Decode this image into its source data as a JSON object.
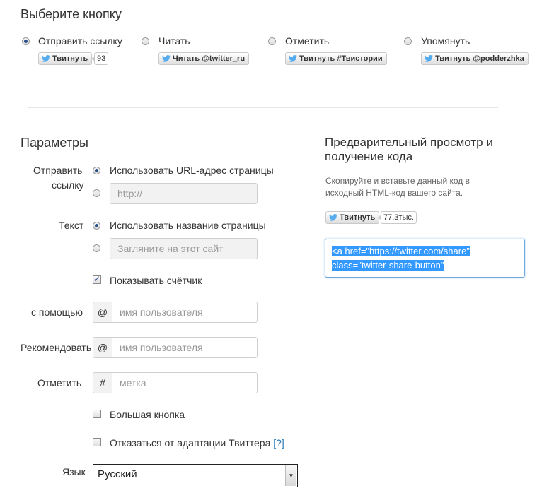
{
  "section1": {
    "title": "Выберите кнопку",
    "options": [
      {
        "label": "Отправить ссылку",
        "button": "Твитнуть",
        "count": "93",
        "checked": true
      },
      {
        "label": "Читать",
        "button": "Читать @twitter_ru",
        "checked": false
      },
      {
        "label": "Отметить",
        "button": "Твитнуть #Твистории",
        "checked": false
      },
      {
        "label": "Упомянуть",
        "button": "Твитнуть @podderzhka",
        "checked": false
      }
    ]
  },
  "params": {
    "title": "Параметры",
    "send_link": {
      "label_line1": "Отправить",
      "label_line2": "ссылку",
      "use_url": "Использовать URL-адрес страницы",
      "url_placeholder": "http://"
    },
    "text": {
      "label": "Текст",
      "use_title": "Использовать название страницы",
      "text_placeholder": "Загляните на этот сайт"
    },
    "show_counter": "Показывать счётчик",
    "via": {
      "label": "с помощью",
      "prefix": "@",
      "placeholder": "имя пользователя"
    },
    "recommend": {
      "label": "Рекомендовать",
      "prefix": "@",
      "placeholder": "имя пользователя"
    },
    "hashtag": {
      "label": "Отметить",
      "prefix": "#",
      "placeholder": "метка"
    },
    "large_button": "Большая кнопка",
    "opt_out": "Отказаться от адаптации Твиттера",
    "opt_out_link": "[?]",
    "language": {
      "label": "Язык",
      "value": "Русский"
    }
  },
  "preview": {
    "title_line1": "Предварительный просмотр и",
    "title_line2": "получение кода",
    "desc_line1": "Скопируйте и вставьте данный код в",
    "desc_line2": "исходный HTML-код вашего сайта.",
    "button": "Твитнуть",
    "count": "77,3тыс.",
    "code_line1": "<a href=\"https://twitter.com/share\"",
    "code_line2": "class=\"twitter-share-button\""
  },
  "colors": {
    "twitter_blue": "#55acee",
    "selection": "#3399ff"
  }
}
